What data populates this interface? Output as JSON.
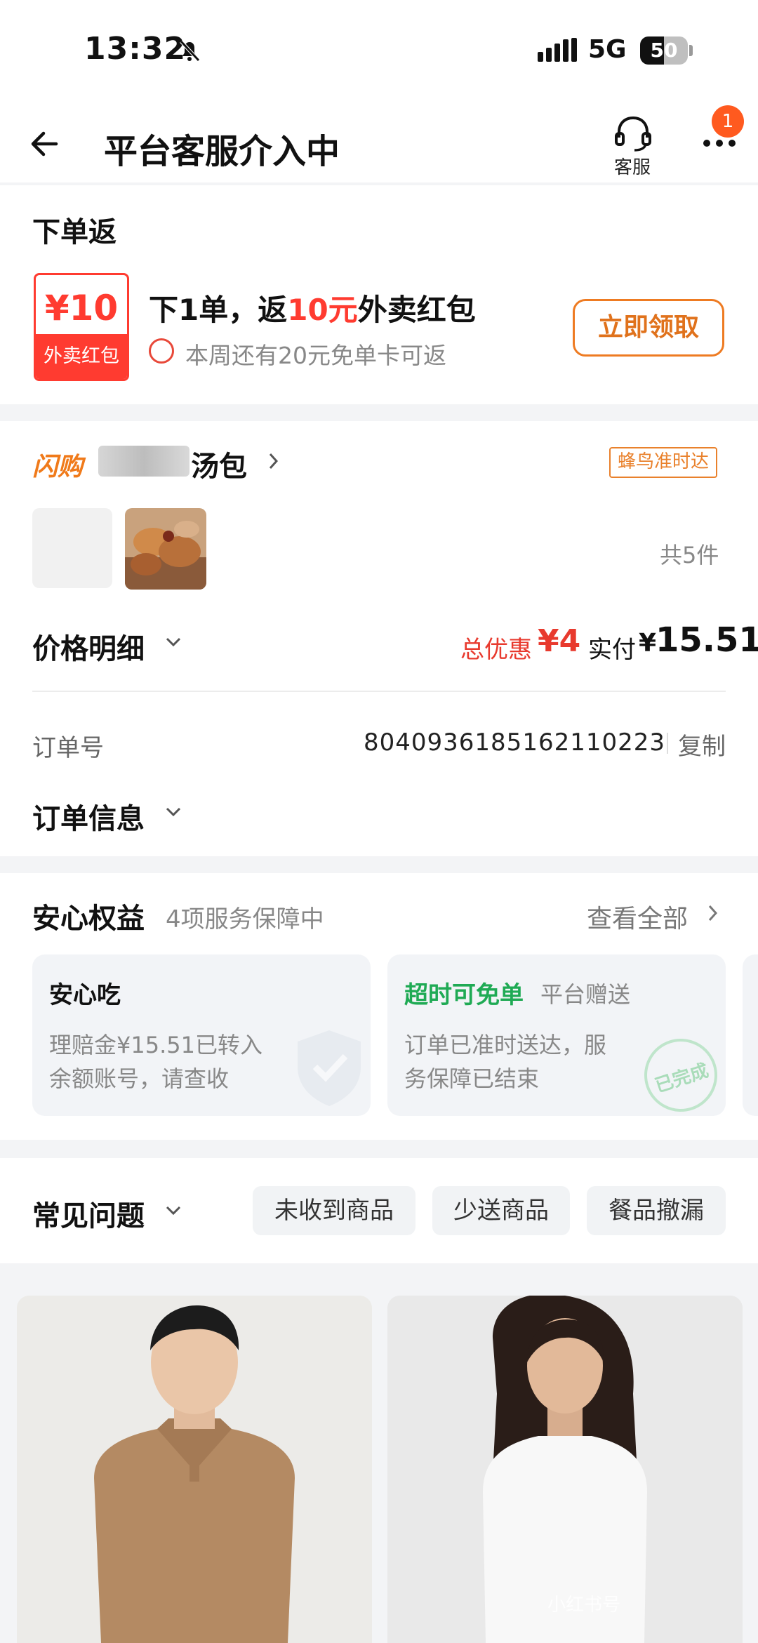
{
  "status_bar": {
    "time": "13:32",
    "network": "5G",
    "battery": "50"
  },
  "nav": {
    "title": "平台客服介入中",
    "cs_label": "客服",
    "badge": "1"
  },
  "rebate": {
    "title": "下单返",
    "coupon_amount": "¥10",
    "coupon_label": "外卖红包",
    "headline_pre": "下1单，返",
    "headline_amount": "10元",
    "headline_post": "外卖红包",
    "sub": "本周还有20元免单卡可返",
    "button": "立即领取"
  },
  "order": {
    "brand_tag": "闪购",
    "store_suffix": "汤包",
    "delivery_tag": "蜂鸟准时达",
    "item_count": "共5件",
    "price_detail_label": "价格明细",
    "discount_label": "总优惠",
    "discount_value": "¥4",
    "paid_label": "实付",
    "paid_currency": "¥",
    "paid_value": "15.51",
    "order_no_label": "订单号",
    "order_no": "8040936185162110223",
    "copy_label": "复制",
    "order_info_label": "订单信息"
  },
  "benefits": {
    "title": "安心权益",
    "subtitle": "4项服务保障中",
    "view_all": "查看全部",
    "cards": [
      {
        "title": "安心吃",
        "desc1": "理赔金¥15.51已转入",
        "desc2": "余额账号，请查收"
      },
      {
        "title": "超时可免单",
        "title_extra": "平台赠送",
        "desc1": "订单已准时送达，服",
        "desc2": "务保障已结束",
        "stamp": "已完成"
      }
    ]
  },
  "faq": {
    "title": "常见问题",
    "chips": [
      "未收到商品",
      "少送商品",
      "餐品撤漏"
    ]
  },
  "watermark": "小红书号"
}
